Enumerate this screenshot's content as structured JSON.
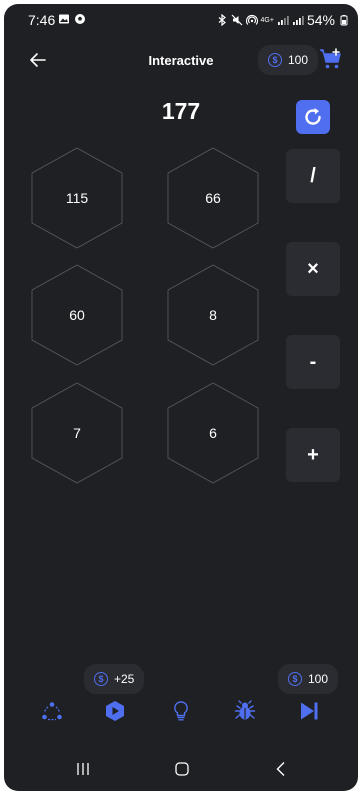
{
  "status_bar": {
    "time": "7:46",
    "battery": "54%",
    "network": "4G+"
  },
  "header": {
    "title": "Interactive",
    "coins": "100"
  },
  "game": {
    "target": "177",
    "tiles": [
      "115",
      "66",
      "60",
      "8",
      "7",
      "6"
    ],
    "operators": [
      "/",
      "×",
      "-",
      "+"
    ]
  },
  "footer": {
    "reward": "+25",
    "coins": "100",
    "coin_symbol": "$"
  },
  "colors": {
    "accent": "#4f6ff0",
    "background": "#1f2024",
    "surface": "#2b2c31"
  },
  "nav_tabs": [
    "group-icon",
    "play-hexagon-icon",
    "lightbulb-icon",
    "bug-icon",
    "skip-next-icon"
  ]
}
